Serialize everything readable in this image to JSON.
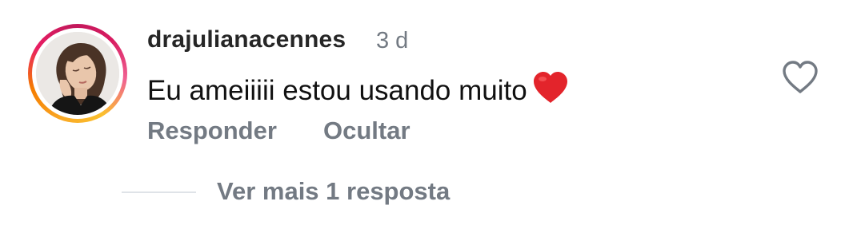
{
  "comment": {
    "username": "drajulianacennes",
    "timestamp": "3 d",
    "text": "Eu ameiiiii estou usando muito",
    "emoji": "heart-emoji"
  },
  "actions": {
    "reply_label": "Responder",
    "hide_label": "Ocultar"
  },
  "like": {
    "icon": "heart-outline-icon"
  },
  "replies": {
    "more_label": "Ver mais 1 resposta"
  },
  "colors": {
    "username": "#262626",
    "secondary": "#737a83",
    "text": "#111111",
    "heart_red": "#e3242b",
    "story_ring_start": "#f9a825",
    "story_ring_end": "#d81b60"
  }
}
